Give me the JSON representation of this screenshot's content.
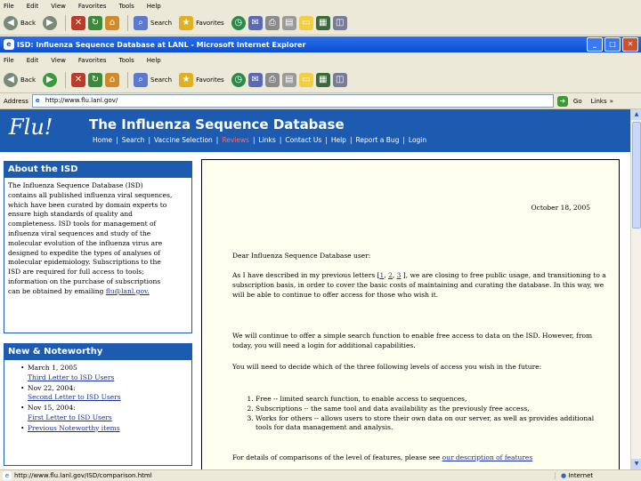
{
  "bg_window": {
    "menu": [
      "File",
      "Edit",
      "View",
      "Favorites",
      "Tools",
      "Help"
    ],
    "toolbar": {
      "back": "Back",
      "search": "Search",
      "favorites": "Favorites"
    }
  },
  "window": {
    "title": "ISD: Influenza Sequence Database at LANL - Microsoft Internet Explorer",
    "menu": [
      "File",
      "Edit",
      "View",
      "Favorites",
      "Tools",
      "Help"
    ],
    "toolbar": {
      "back": "Back",
      "search": "Search",
      "favorites": "Favorites"
    },
    "address": {
      "value": "http://www.flu.lanl.gov/",
      "go": "Go",
      "links": "Links"
    }
  },
  "site": {
    "logo": "Flu!",
    "title": "The Influenza Sequence Database",
    "nav": [
      "Home",
      "Search",
      "Vaccine Selection",
      "Reviews",
      "Links",
      "Contact Us",
      "Help",
      "Report a Bug",
      "Login"
    ],
    "active_nav": "Reviews"
  },
  "about": {
    "heading": "About the ISD",
    "lines": [
      "The Influenza Sequence Database (ISD)",
      "contains all published influenza viral sequences,",
      "which have been curated by domain experts to",
      "ensure high standards of quality and",
      "completeness. ISD tools for management of",
      "influenza viral sequences and study of the",
      "molecular evolution of the influenza virus are",
      "designed to expedite the types of analyses of",
      "molecular epidemiology. Subscriptions to the",
      "ISD are required for full access to tools;",
      "information on the purchase of subscriptions",
      "can be obtained by emailing"
    ],
    "email": "flu@lanl.gov."
  },
  "news": {
    "heading": "New & Noteworthy",
    "items": [
      {
        "date": "March 1, 2005",
        "link": "Third Letter to ISD Users"
      },
      {
        "date": "Nov 22, 2004:",
        "link": "Second Letter to ISD Users"
      },
      {
        "date": "Nov 15, 2004:",
        "link": "First Letter to ISD Users"
      },
      {
        "date": "",
        "link": "Previous Noteworthy items"
      }
    ]
  },
  "letter": {
    "date": "October 18, 2005",
    "greeting": "Dear Influenza Sequence Database user:",
    "p1_start": "As I have described in my previous letters [",
    "refs": [
      "1",
      "2",
      "3"
    ],
    "p1_rest": "], we are closing to free public usage, and transitioning to a subscription basis, in order to cover the basic costs of maintaining and curating the database. In this way, we will be able to continue to offer access for those who wish it.",
    "p2": "We will continue to offer a simple search function to enable free access to data on the ISD. However, from today, you will need a login for additional capabilities.",
    "p3": "You will need to decide which of the three following levels of access you wish in the future:",
    "options": [
      "Free -- limited search function, to enable access to sequences,",
      "Subscriptions -- the same tool and data availability as the previously free access,",
      "Works for others -- allows users to store their own data on our server, as well as provides additional tools for data management and analysis."
    ],
    "p4_start": "For details of comparisons of the level of features, please see",
    "p4_link": "our description of features"
  },
  "status": {
    "text": "http://www.flu.lanl.gov/ISD/comparison.html",
    "zone": "Internet"
  }
}
